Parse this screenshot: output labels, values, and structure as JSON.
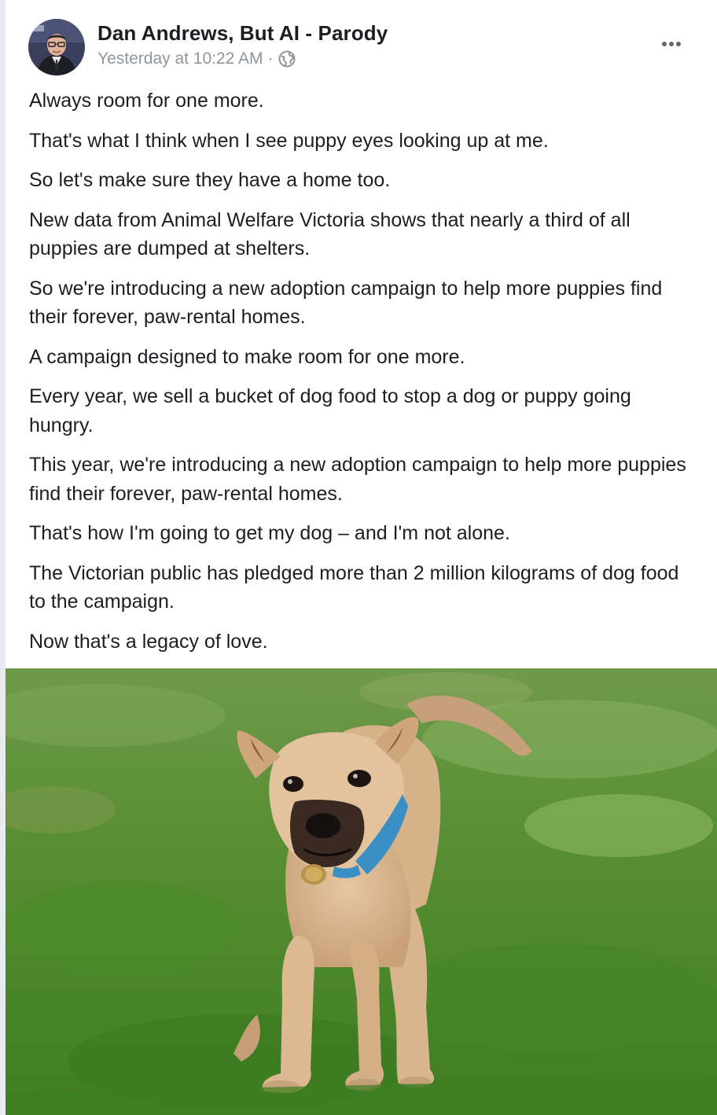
{
  "post": {
    "author": "Dan Andrews, But AI - Parody",
    "timestamp": "Yesterday at 10:22 AM",
    "separator": "·",
    "privacy_icon": "globe-icon",
    "more_icon": "more-options-icon",
    "paragraphs": [
      "Always room for one more.",
      "That's what I think when I see puppy eyes looking up at me.",
      "So let's make sure they have a home too.",
      "New data from Animal Welfare Victoria shows that nearly a third of all puppies are dumped at shelters.",
      "So we're introducing a new adoption campaign to help more puppies find their forever, paw-rental homes.",
      "A campaign designed to make room for one more.",
      "Every year, we sell a bucket of dog food to stop a dog or puppy going hungry.",
      "This year, we're introducing a new adoption campaign to help more puppies find their forever, paw-rental homes.",
      "That's how I'm going to get my dog – and I'm not alone.",
      "The Victorian public has pledged more than 2 million kilograms of dog food to the campaign.",
      "Now that's a legacy of love."
    ]
  },
  "colors": {
    "text_primary": "#1c1e21",
    "text_secondary": "#90949c",
    "grass": "#4f8a2e",
    "dog_fur": "#d9b58c",
    "collar": "#3a8fc4"
  }
}
